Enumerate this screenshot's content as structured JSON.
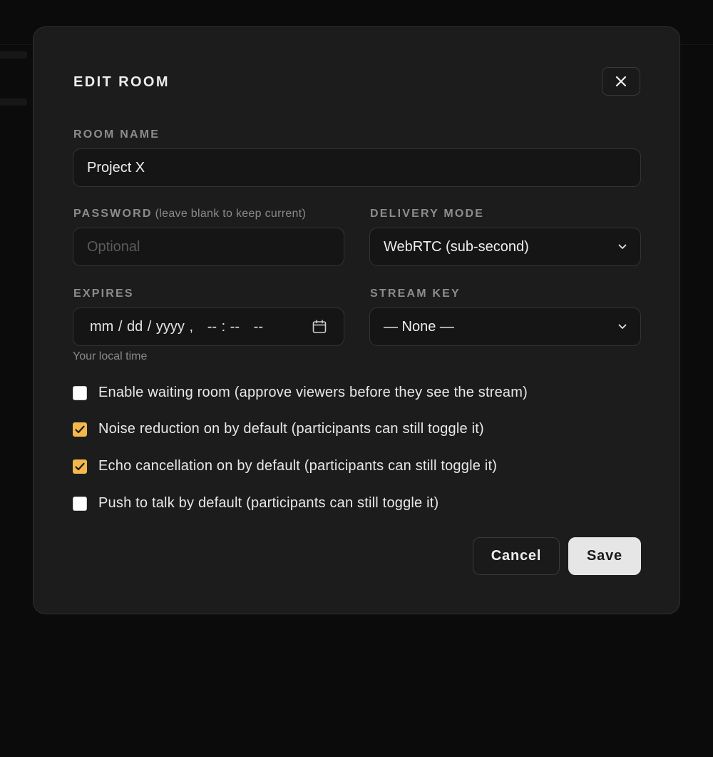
{
  "dialog": {
    "title": "EDIT ROOM",
    "close_label": "close"
  },
  "room_name": {
    "label": "ROOM NAME",
    "value": "Project X"
  },
  "password": {
    "label": "PASSWORD",
    "hint": "(leave blank to keep current)",
    "placeholder": "Optional",
    "value": ""
  },
  "delivery_mode": {
    "label": "DELIVERY MODE",
    "selected": "WebRTC (sub-second)"
  },
  "expires": {
    "label": "EXPIRES",
    "value": "mm / dd / yyyy ,   -- : --   --",
    "helper": "Your local time"
  },
  "stream_key": {
    "label": "STREAM KEY",
    "selected": "— None —"
  },
  "options": [
    {
      "label": "Enable waiting room (approve viewers before they see the stream)",
      "checked": false
    },
    {
      "label": "Noise reduction on by default (participants can still toggle it)",
      "checked": true
    },
    {
      "label": "Echo cancellation on by default (participants can still toggle it)",
      "checked": true
    },
    {
      "label": "Push to talk by default (participants can still toggle it)",
      "checked": false
    }
  ],
  "actions": {
    "cancel_label": "Cancel",
    "save_label": "Save"
  },
  "colors": {
    "accent": "#f2b84b",
    "modal_bg": "#1c1c1c",
    "page_bg": "#0b0b0b"
  },
  "icons": {
    "close": "close-icon",
    "calendar": "calendar-icon",
    "chevron": "chevron-down-icon",
    "check": "checkmark-icon"
  }
}
